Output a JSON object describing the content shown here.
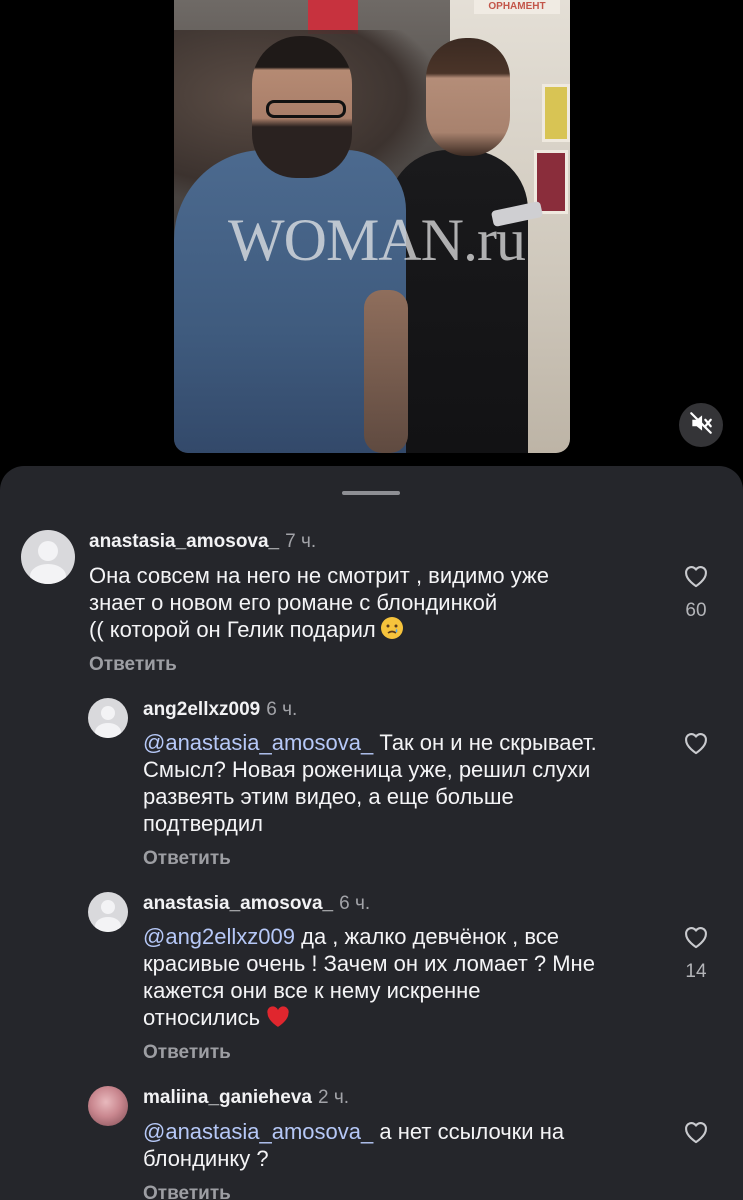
{
  "video": {
    "watermark": "WOMAN.ru",
    "background_sign": "ОРНАМЕНТ",
    "mute_button_icon": "speaker-muted-icon"
  },
  "colors": {
    "sheet_background": "#25262b",
    "mention": "#b6c8f7",
    "muted_text": "#9d9ea3",
    "heart_emoji": "#e0262e"
  },
  "comments": [
    {
      "username": "anastasia_amosova_",
      "time": "7 ч.",
      "lines": [
        "Она совсем на него не смотрит , видимо уже",
        "знает о новом его романе с блондинкой",
        "(( которой он Гелик подарил"
      ],
      "emoji": "crying-face-emoji",
      "reply_label": "Ответить",
      "likes": "60",
      "like_icon": "heart-outline-icon"
    },
    {
      "username": "ang2ellxz009",
      "time": "6 ч.",
      "mention": "@anastasia_amosova_",
      "lines": [
        "Так он и не скрывает.",
        "Смысл? Новая роженица уже, решил слухи",
        "развеять этим видео, а еще больше",
        "подтвердил"
      ],
      "reply_label": "Ответить",
      "likes": "",
      "like_icon": "heart-outline-icon"
    },
    {
      "username": "anastasia_amosova_",
      "time": "6 ч.",
      "mention": "@ang2ellxz009",
      "lines": [
        "да , жалко девчёнок , все",
        "красивые очень ! Зачем он их ломает ? Мне",
        "кажется они все к нему искренне",
        "относились"
      ],
      "emoji": "red-heart-emoji",
      "reply_label": "Ответить",
      "likes": "14",
      "like_icon": "heart-outline-icon"
    },
    {
      "username": "maliina_ganieheva",
      "time": "2 ч.",
      "mention": "@anastasia_amosova_",
      "lines": [
        "а нет ссылочки на",
        "блондинку ?"
      ],
      "reply_label": "Ответить",
      "likes": "",
      "like_icon": "heart-outline-icon"
    }
  ]
}
